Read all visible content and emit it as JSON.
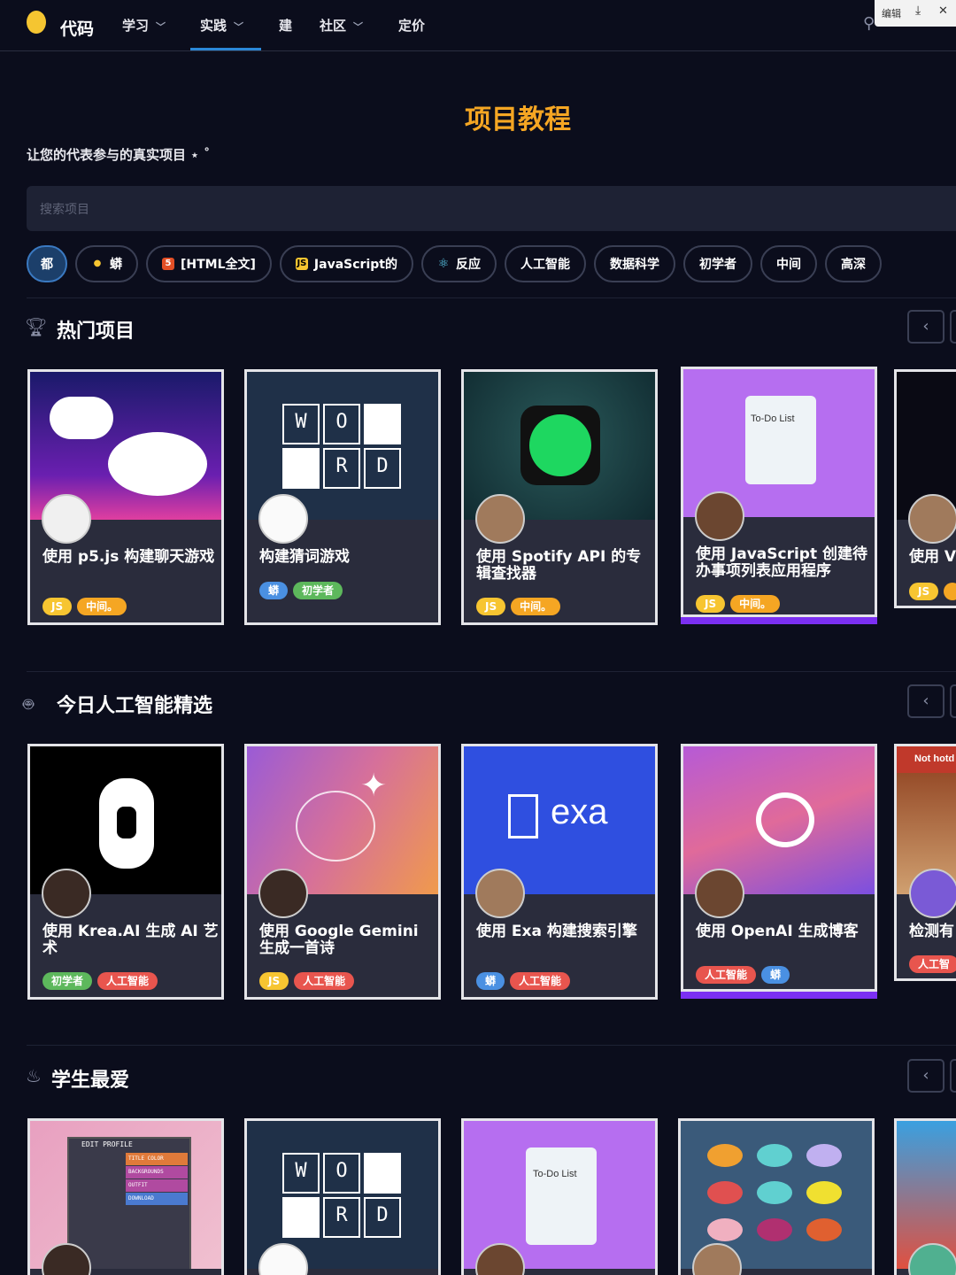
{
  "nav": {
    "logo": "",
    "brand": "代码",
    "items": [
      {
        "label": "学习",
        "dropdown": true
      },
      {
        "label": "实践",
        "dropdown": true
      },
      {
        "label": "建",
        "dropdown": false
      },
      {
        "label": "社区",
        "dropdown": true
      },
      {
        "label": "定价",
        "dropdown": false
      }
    ],
    "active_item": "实践",
    "toolbar": {
      "edit": "编辑",
      "download": "⤓",
      "close": "✕"
    }
  },
  "header": {
    "title": "项目教程",
    "subtitle": "让您的代表参与的真实项目 ⋆ ˚",
    "search_placeholder": "搜索项目"
  },
  "filters": [
    {
      "label": "都",
      "active": true,
      "icon": null
    },
    {
      "label": "蟒",
      "icon": "python-icon",
      "icon_color": "#3776ab"
    },
    {
      "label": "[HTML全文]",
      "icon": "html5-icon",
      "icon_color": "#e34f26"
    },
    {
      "label": "JavaScript的",
      "icon": "javascript-icon",
      "icon_color": "#f7c531"
    },
    {
      "label": "反应",
      "icon": "react-icon",
      "icon_color": "#61dafb"
    },
    {
      "label": "人工智能",
      "icon": null
    },
    {
      "label": "数据科学",
      "icon": null
    },
    {
      "label": "初学者",
      "icon": null
    },
    {
      "label": "中间",
      "icon": null
    },
    {
      "label": "高深",
      "icon": null
    }
  ],
  "sections": [
    {
      "title": "热门项目",
      "icon": "trophy-icon",
      "cards": [
        {
          "title": "使用 p5.js 构建聊天游戏",
          "tags": [
            {
              "label": "JS",
              "type": "js"
            },
            {
              "label": "中间。",
              "type": "mid"
            }
          ]
        },
        {
          "title": "构建猜词游戏",
          "tags": [
            {
              "label": "蟒",
              "type": "py"
            },
            {
              "label": "初学者",
              "type": "beg"
            }
          ]
        },
        {
          "title": "使用 Spotify API 的专辑查找器",
          "tags": [
            {
              "label": "JS",
              "type": "js"
            },
            {
              "label": "中间。",
              "type": "mid"
            }
          ]
        },
        {
          "title": "使用 JavaScript 创建待办事项列表应用程序",
          "tags": [
            {
              "label": "JS",
              "type": "js"
            },
            {
              "label": "中间。",
              "type": "mid"
            }
          ]
        },
        {
          "title": "使用 V",
          "tags": [
            {
              "label": "JS",
              "type": "js"
            },
            {
              "label": "",
              "type": "mid"
            }
          ]
        }
      ]
    },
    {
      "title": "今日人工智能精选",
      "icon": "robot-icon",
      "cards": [
        {
          "title": "使用 Krea.AI 生成 AI 艺术",
          "tags": [
            {
              "label": "初学者",
              "type": "beg"
            },
            {
              "label": "人工智能",
              "type": "ai"
            }
          ]
        },
        {
          "title": "使用 Google Gemini 生成一首诗",
          "tags": [
            {
              "label": "JS",
              "type": "js"
            },
            {
              "label": "人工智能",
              "type": "ai"
            }
          ]
        },
        {
          "title": "使用 Exa 构建搜索引擎",
          "tags": [
            {
              "label": "蟒",
              "type": "py"
            },
            {
              "label": "人工智能",
              "type": "ai"
            }
          ]
        },
        {
          "title": "使用 OpenAI 生成博客",
          "tags": [
            {
              "label": "人工智能",
              "type": "ai"
            },
            {
              "label": "蟒",
              "type": "py"
            }
          ]
        },
        {
          "title": "检测有",
          "tags": [
            {
              "label": "人工智",
              "type": "ai"
            }
          ]
        }
      ]
    },
    {
      "title": "学生最爱",
      "icon": "flame-icon",
      "cards": [
        {
          "title": "",
          "tags": []
        },
        {
          "title": "",
          "tags": []
        },
        {
          "title": "",
          "tags": []
        },
        {
          "title": "",
          "tags": []
        },
        {
          "title": "",
          "tags": []
        }
      ]
    }
  ],
  "thumb_text": {
    "word_tiles": [
      "W",
      "O",
      "",
      "",
      "R",
      "D"
    ],
    "todo": "To-Do List",
    "exa": "exa",
    "not_hotdog": "Not hotd",
    "edit_profile": "EDIT PROFILE",
    "profile_rows": [
      "TITLE COLOR",
      "BACKGROUNDS",
      "OUTFIT",
      "DOWNLOAD"
    ]
  },
  "colors": {
    "accent": "#f5a623",
    "active_tab": "#2b88d8",
    "raised_shadow": "#7b2ff2"
  }
}
